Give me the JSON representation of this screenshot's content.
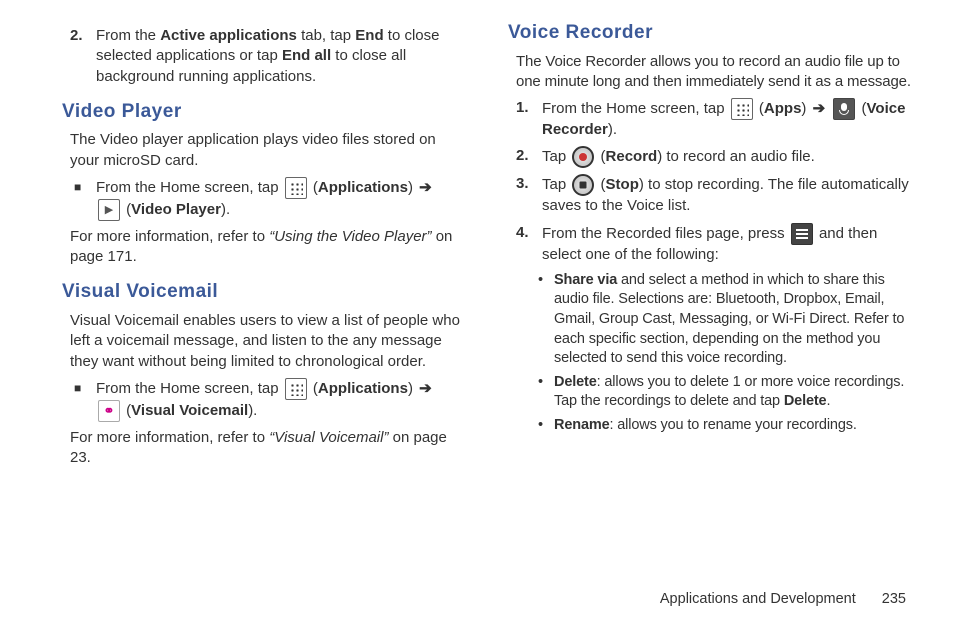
{
  "col_left": {
    "step2": {
      "num": "2.",
      "t1": "From the ",
      "b1": "Active applications",
      "t2": " tab, tap ",
      "b2": "End",
      "t3": " to close selected applications or tap ",
      "b3": "End all",
      "t4": " to close all background running applications."
    },
    "video_player": {
      "heading": "Video Player",
      "desc": "The Video player application plays video files stored on your microSD card.",
      "step": {
        "t1": "From the Home screen, tap ",
        "b1": "Applications",
        "b2": "Video Player"
      },
      "ref": {
        "t1": "For more information, refer to ",
        "it": "“Using the Video Player”",
        "t2": " on page 171."
      }
    },
    "visual_voicemail": {
      "heading": "Visual Voicemail",
      "desc": "Visual Voicemail enables users to view a list of people who left a voicemail message, and listen to the any message they want without being limited to chronological order.",
      "step": {
        "t1": "From the Home screen, tap ",
        "b1": "Applications",
        "b2": "Visual Voicemail"
      },
      "ref": {
        "t1": "For more information, refer to ",
        "it": "“Visual Voicemail”",
        "t2": " on page 23."
      }
    }
  },
  "col_right": {
    "voice_recorder": {
      "heading": "Voice Recorder",
      "desc": "The Voice Recorder allows you to record an audio file up to one minute long and then immediately send it as a message.",
      "step1": {
        "num": "1.",
        "t1": "From the Home screen, tap ",
        "b1": "Apps",
        "b2": "Voice Recorder"
      },
      "step2": {
        "num": "2.",
        "t1": "Tap ",
        "b1": "Record",
        "t2": ") to record an audio file."
      },
      "step3": {
        "num": "3.",
        "t1": "Tap ",
        "b1": "Stop",
        "t2": ") to stop recording. The file automatically saves to the Voice list."
      },
      "step4": {
        "num": "4.",
        "t1": "From the Recorded files page, press ",
        "t2": " and then select one of the following:"
      },
      "sub_share": {
        "b": "Share via",
        "t": " and select a method in which to share this audio file. Selections are: Bluetooth, Dropbox, Email, Gmail, Group Cast, Messaging, or Wi-Fi Direct. Refer to each specific section, depending on the method you selected to send this voice recording."
      },
      "sub_delete": {
        "b": "Delete",
        "t1": ": allows you to delete 1 or more voice recordings. Tap the recordings to delete and tap ",
        "b2": "Delete",
        "t2": "."
      },
      "sub_rename": {
        "b": "Rename",
        "t": ": allows you to rename your recordings."
      }
    }
  },
  "footer": {
    "section": "Applications and Development",
    "page": "235"
  },
  "glyph": {
    "arrow": "➔",
    "square": "■",
    "dot": "•",
    "play": "▶"
  }
}
